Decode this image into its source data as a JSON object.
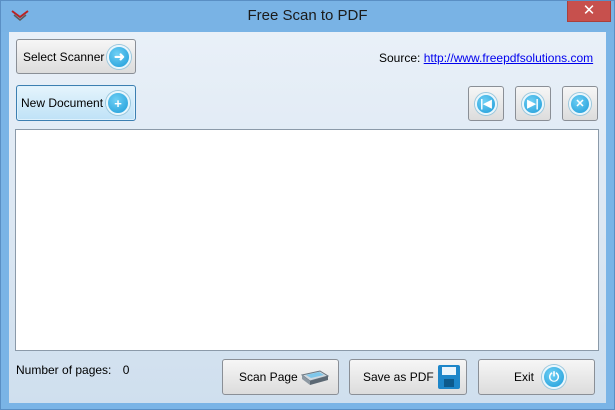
{
  "window": {
    "title": "Free Scan to PDF",
    "close_label": "✕"
  },
  "toolbar": {
    "select_scanner_label": "Select Scanner",
    "new_document_label": "New Document",
    "source_label": "Source:",
    "source_link": "http://www.freepdfsolutions.com",
    "nav_prev_icon": "first-page-icon",
    "nav_next_icon": "last-page-icon",
    "delete_icon": "delete-icon"
  },
  "footer": {
    "pages_label": "Number of pages:",
    "pages_count": "0",
    "scan_page_label": "Scan Page",
    "save_pdf_label": "Save as PDF",
    "exit_label": "Exit"
  },
  "colors": {
    "title_bar": "#79b3e5",
    "close_button": "#c7504d",
    "accent_icon": "#1d9bd8",
    "link": "#0000ee"
  }
}
